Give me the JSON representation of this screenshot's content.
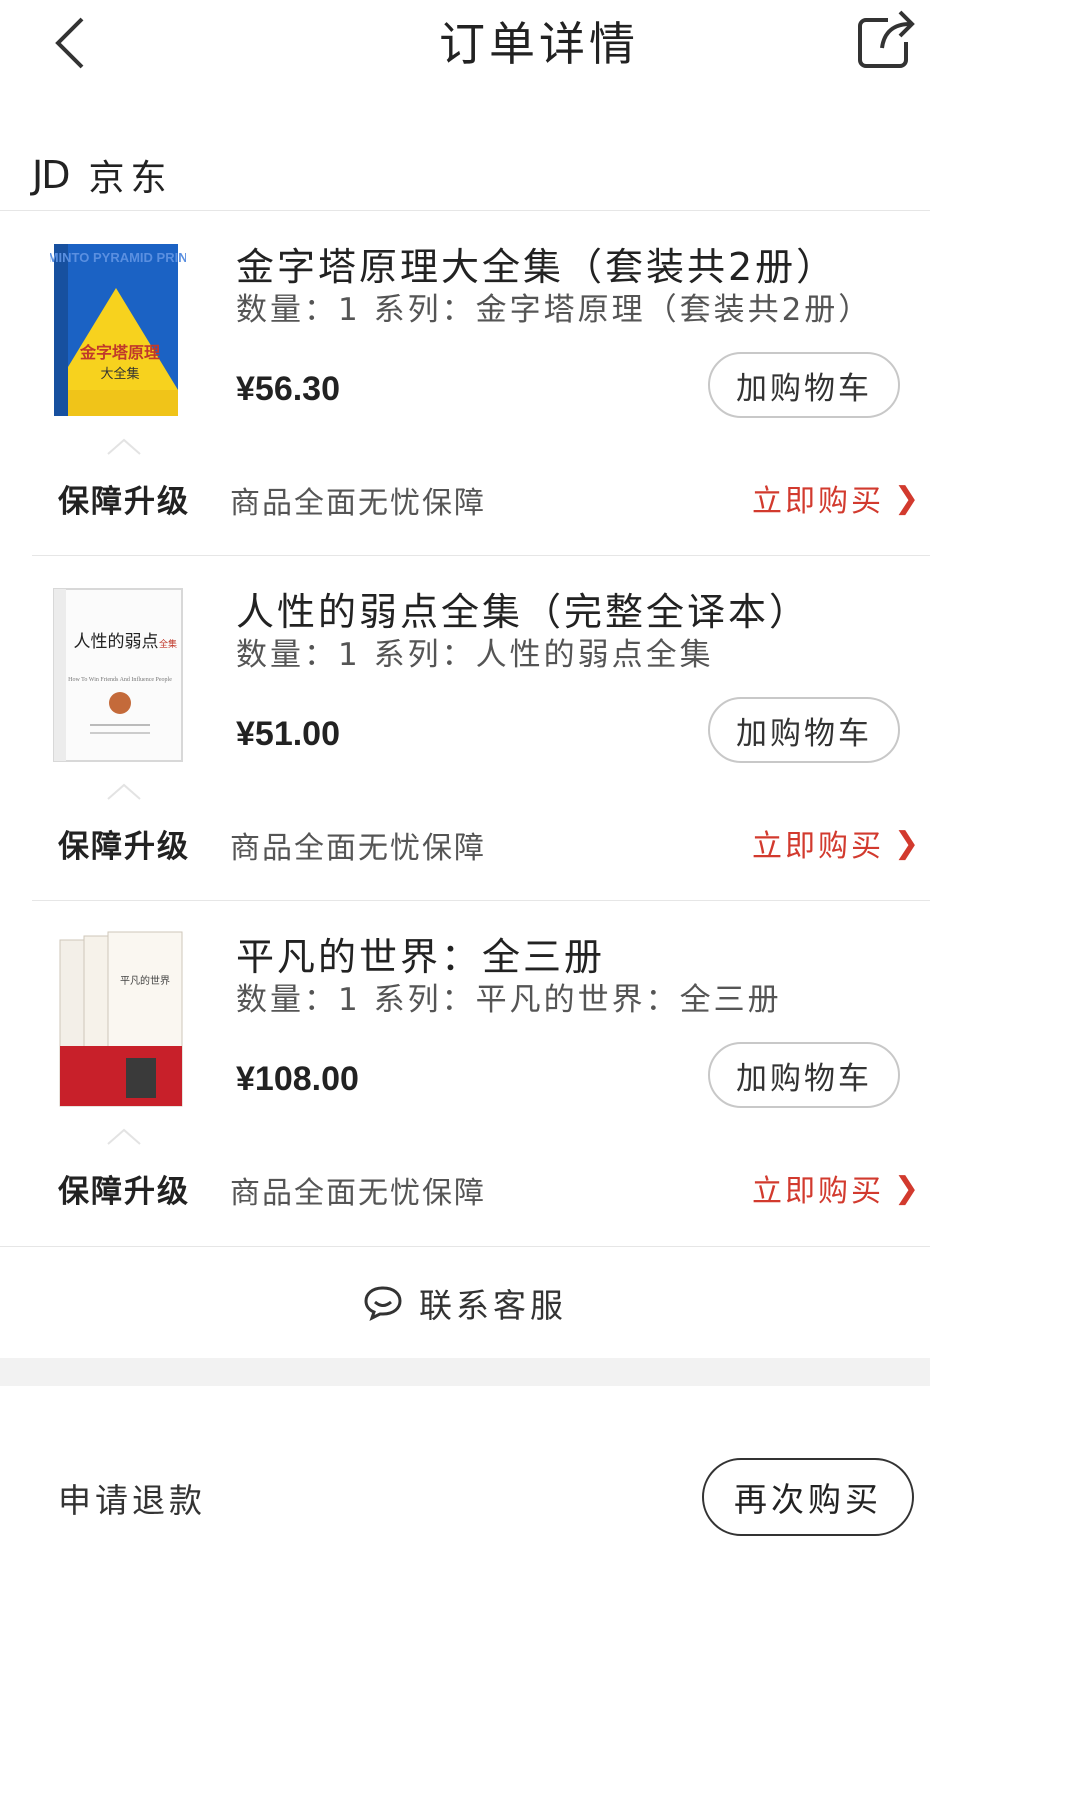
{
  "header": {
    "title": "订单详情",
    "back_icon": "chevron-left-icon",
    "share_icon": "share-icon"
  },
  "shop": {
    "logo": "JD",
    "name": "京东"
  },
  "products": [
    {
      "title": "金字塔原理大全集（套装共2册）",
      "spec": "数量：1  系列：金字塔原理（套装共2册）",
      "price": "¥56.30",
      "add_cart_label": "加购物车",
      "guarantee_label": "保障升级",
      "guarantee_desc": "商品全面无忧保障",
      "buy_now_label": "立即购买",
      "cover": {
        "style": "yellow-blue",
        "headline_en": "THE MINTO PYRAMID PRINCIPLE",
        "title_cn": "金字塔原理",
        "subtitle_cn": "大全集"
      }
    },
    {
      "title": "人性的弱点全集（完整全译本）",
      "spec": "数量：1  系列：人性的弱点全集",
      "price": "¥51.00",
      "add_cart_label": "加购物车",
      "guarantee_label": "保障升级",
      "guarantee_desc": "商品全面无忧保障",
      "buy_now_label": "立即购买",
      "cover": {
        "style": "white",
        "title_cn": "人性的弱点",
        "subtitle_cn": "全集",
        "headline_en": "How To Win Friends And Influence People"
      }
    },
    {
      "title": "平凡的世界：全三册",
      "spec": "数量：1  系列：平凡的世界：全三册",
      "price": "¥108.00",
      "add_cart_label": "加购物车",
      "guarantee_label": "保障升级",
      "guarantee_desc": "商品全面无忧保障",
      "buy_now_label": "立即购买",
      "cover": {
        "style": "red-white",
        "title_cn": "平凡的世界"
      }
    }
  ],
  "contact": {
    "label": "联系客服",
    "icon": "chat-bubble-icon"
  },
  "bottom_bar": {
    "refund_label": "申请退款",
    "rebuy_label": "再次购买"
  },
  "colors": {
    "accent_red": "#d23a2e",
    "text_dark": "#222222",
    "divider": "#e6e6e6"
  }
}
